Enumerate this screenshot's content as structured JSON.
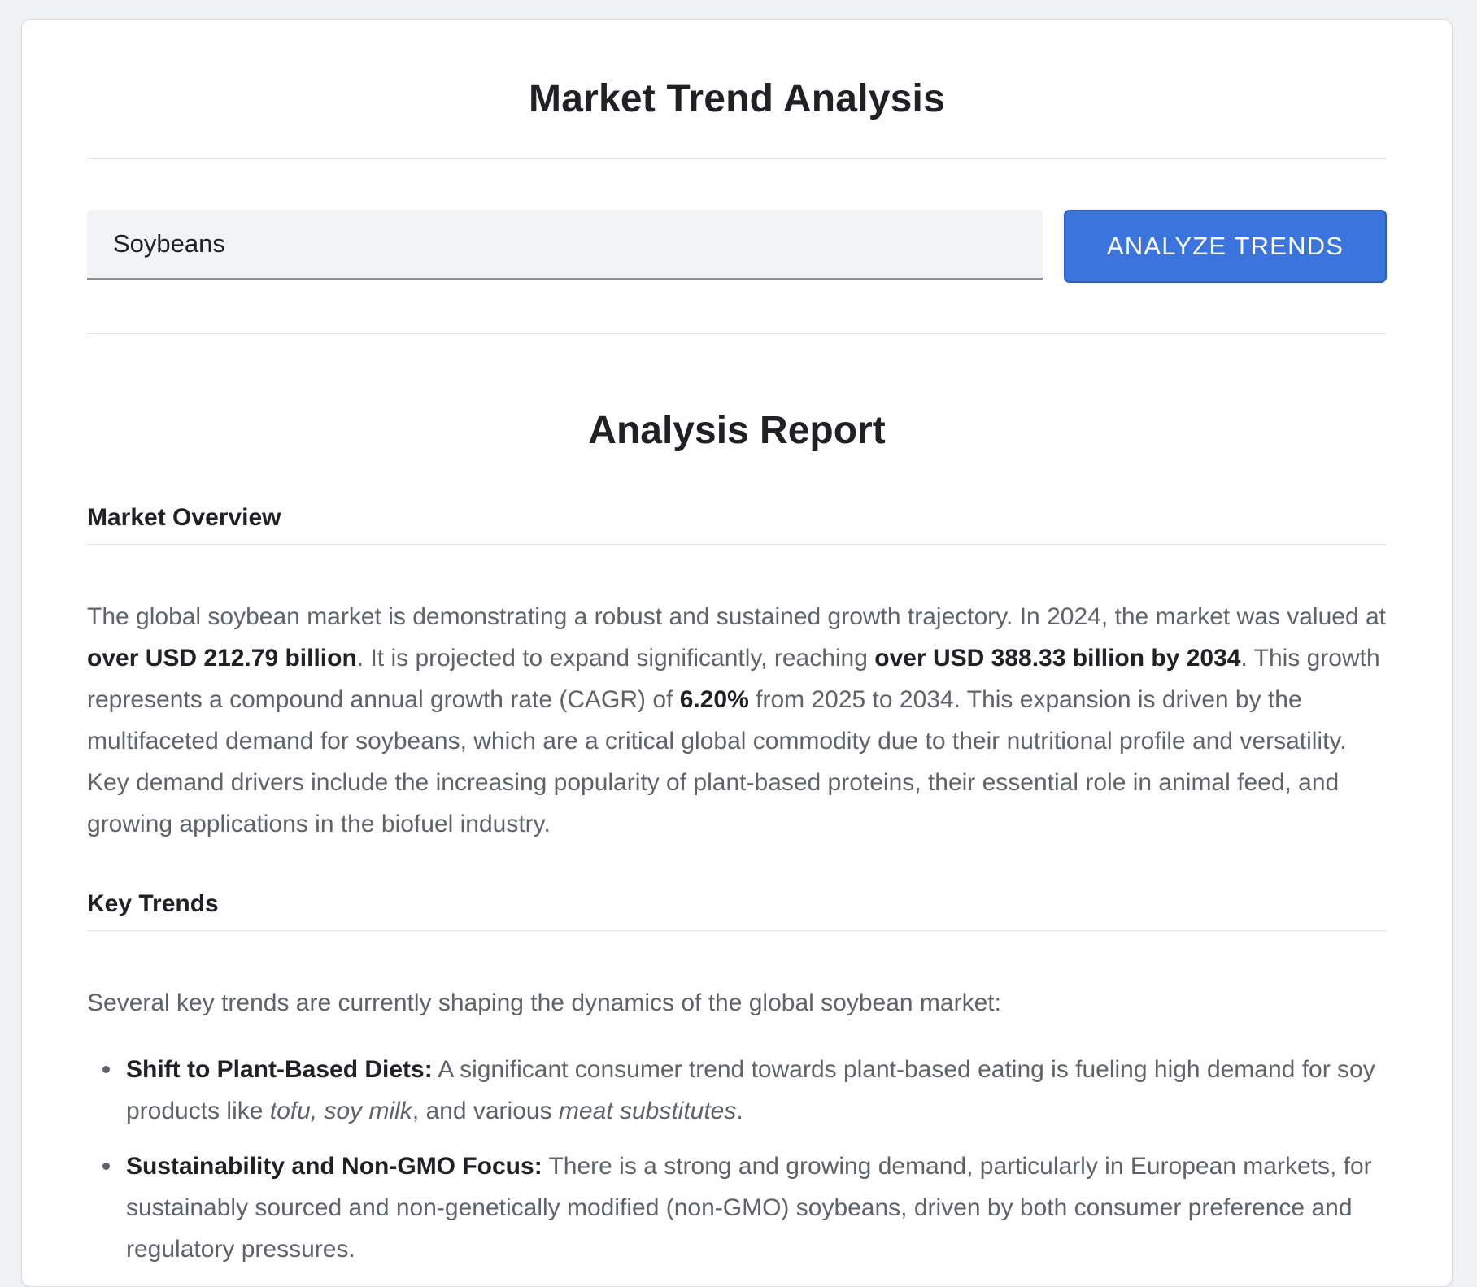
{
  "app": {
    "title": "Market Trend Analysis"
  },
  "search": {
    "value": "Soybeans",
    "button_label": "ANALYZE TRENDS"
  },
  "report": {
    "title": "Analysis Report",
    "market_overview": {
      "heading": "Market Overview",
      "text_1": "The global soybean market is demonstrating a robust and sustained growth trajectory. In 2024, the market was valued at ",
      "value_2024": "over USD 212.79 billion",
      "text_2": ". It is projected to expand significantly, reaching ",
      "value_2034": "over USD 388.33 billion by 2034",
      "text_3": ". This growth represents a compound annual growth rate (CAGR) of ",
      "cagr": "6.20%",
      "text_4": " from 2025 to 2034. This expansion is driven by the multifaceted demand for soybeans, which are a critical global commodity due to their nutritional profile and versatility. Key demand drivers include the increasing popularity of plant-based proteins, their essential role in animal feed, and growing applications in the biofuel industry."
    },
    "key_trends": {
      "heading": "Key Trends",
      "intro": "Several key trends are currently shaping the dynamics of the global soybean market:",
      "items": [
        {
          "title": "Shift to Plant-Based Diets:",
          "text_1": " A significant consumer trend towards plant-based eating is fueling high demand for soy products like ",
          "italic_1": "tofu, soy milk",
          "text_2": ", and various ",
          "italic_2": "meat substitutes",
          "text_3": "."
        },
        {
          "title": "Sustainability and Non-GMO Focus:",
          "text_1": " There is a strong and growing demand, particularly in European markets, for sustainably sourced and non-genetically modified (non-GMO) soybeans, driven by both consumer preference and regulatory pressures."
        }
      ]
    }
  }
}
